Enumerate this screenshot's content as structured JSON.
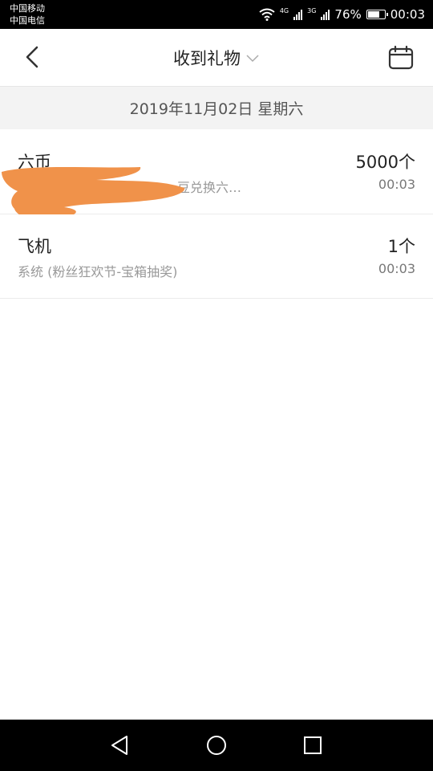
{
  "status_bar": {
    "carrier_1": "中国移动",
    "carrier_2": "中国电信",
    "net_1": "4G",
    "net_2": "3G",
    "battery_percent": "76%",
    "battery_level": 0.76,
    "time": "00:03"
  },
  "header": {
    "title": "收到礼物",
    "back_icon": "chevron-left-icon",
    "dropdown_icon": "chevron-down-icon",
    "calendar_icon": "calendar-icon"
  },
  "date_band": {
    "label": "2019年11月02日 星期六"
  },
  "gifts": [
    {
      "name": "六币",
      "source": "…豆兑换六…",
      "count": "5000个",
      "time": "00:03"
    },
    {
      "name": "飞机",
      "source": "系统 (粉丝狂欢节-宝箱抽奖)",
      "count": "1个",
      "time": "00:03"
    }
  ],
  "nav": {
    "back_icon": "triangle-back-icon",
    "home_icon": "circle-home-icon",
    "recents_icon": "square-recents-icon"
  },
  "colors": {
    "redaction": "#f0924a",
    "band": "#f3f3f3"
  }
}
